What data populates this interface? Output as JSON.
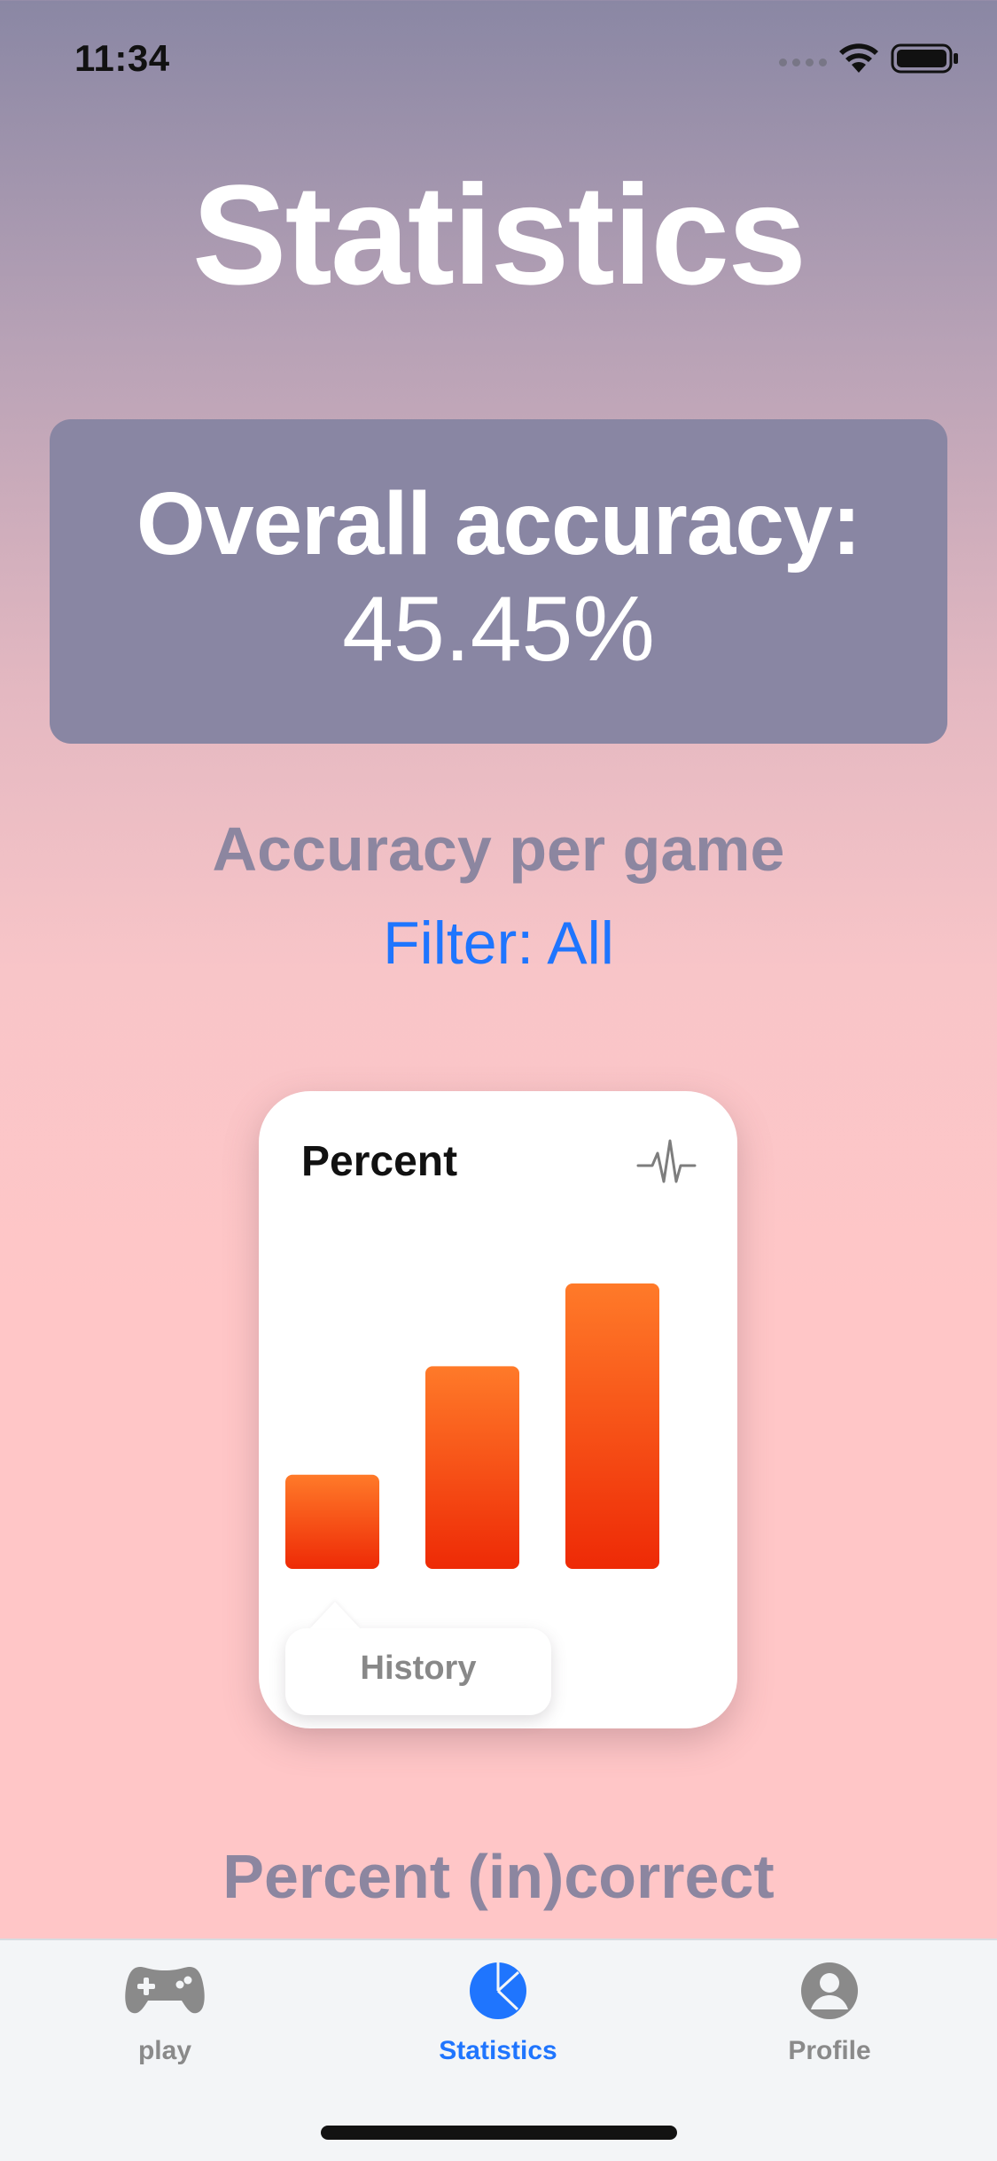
{
  "status_bar": {
    "time": "11:34"
  },
  "page": {
    "title": "Statistics"
  },
  "accuracy_card": {
    "label": "Overall accuracy:",
    "value": "45.45%"
  },
  "section": {
    "title": "Accuracy per game",
    "filter_label": "Filter: All"
  },
  "chart_card": {
    "title": "Percent",
    "tooltip_label": "History",
    "icon": "pulse-icon",
    "bar_colors": [
      "#ff7a29",
      "#ee2a06"
    ]
  },
  "chart_data": {
    "type": "bar",
    "categories": [],
    "values": [
      0.33,
      0.71,
      1.0
    ],
    "title": "",
    "xlabel": "",
    "ylabel": "",
    "ylim": [
      0,
      1
    ]
  },
  "section_2": {
    "title": "Percent (in)correct"
  },
  "tab_bar": {
    "items": [
      {
        "label": "play",
        "icon": "gamepad-icon",
        "active": false
      },
      {
        "label": "Statistics",
        "icon": "pie-chart-icon",
        "active": true
      },
      {
        "label": "Profile",
        "icon": "person-icon",
        "active": false
      }
    ],
    "active_color": "#1f75fe",
    "inactive_color": "#8a8a8a"
  }
}
